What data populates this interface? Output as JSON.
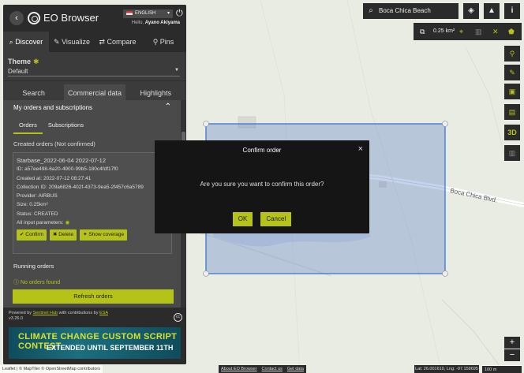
{
  "header": {
    "app_title": "EO Browser",
    "language": "ENGLISH",
    "hello_prefix": "Hello,",
    "user_name": "Ayano Akiyama"
  },
  "main_tabs": [
    {
      "label": "Discover",
      "icon": "search-icon"
    },
    {
      "label": "Visualize",
      "icon": "brush-icon"
    },
    {
      "label": "Compare",
      "icon": "compare-arrows-icon"
    },
    {
      "label": "Pins",
      "icon": "pin-icon"
    }
  ],
  "theme": {
    "label": "Theme",
    "value": "Default"
  },
  "sub_tabs": [
    "Search",
    "Commercial data",
    "Highlights"
  ],
  "orders": {
    "section_title": "My orders and subscriptions",
    "tabs": [
      "Orders",
      "Subscriptions"
    ],
    "created_title": "Created orders (Not confirmed)",
    "card": {
      "name": "Starbase_2022-06-04    2022-07-12",
      "id": "ID: a57ee498-6a20-4900-99b5-180c4fdf17f0",
      "created_at": "Created at: 2022-07-12 08:27:41",
      "collection_id": "Collection ID: 209a6826-402f-4373-9ea5-2f457c6a5789",
      "provider": "Provider: AIRBUS",
      "size": "Size: 0.25km²",
      "status": "Status: CREATED",
      "input_params": "All input parameters:"
    },
    "buttons": {
      "confirm": "✔ Confirm",
      "delete": "✖ Delete",
      "show_coverage": "✦ Show coverage"
    },
    "running_title": "Running orders",
    "no_orders": "ⓘ No orders found",
    "refresh": "Refresh orders"
  },
  "footer": {
    "powered_by": "Powered by",
    "sentinel_hub": "Sentinel Hub",
    "with_contrib": "with contributions by",
    "esa": "ESA",
    "version": "v3.26.0",
    "banner_line1": "CLIMATE CHANGE CUSTOM SCRIPT CONTEST",
    "banner_line2": "EXTENDED UNTIL SEPTEMBER 11TH"
  },
  "search": {
    "query": "Boca Chica Beach"
  },
  "measure": {
    "area": "0.25 km²"
  },
  "map_label": "Boca Chica Blvd.",
  "bottom": {
    "attribution": "Leaflet | © MapTiler © OpenStreetMap contributors",
    "about": "About EO Browser",
    "contact": "Contact us",
    "get_data": "Get data",
    "coords": "Lat: 26.001610, Lng: -97.159695",
    "scale": "100 m"
  },
  "modal": {
    "title": "Confirm order",
    "body": "Are you sure you want to confirm this order?",
    "ok": "OK",
    "cancel": "Cancel"
  },
  "colors": {
    "accent": "#b5c218",
    "panel": "#3b3b3b",
    "aoi_stroke": "#2f6fd0"
  }
}
